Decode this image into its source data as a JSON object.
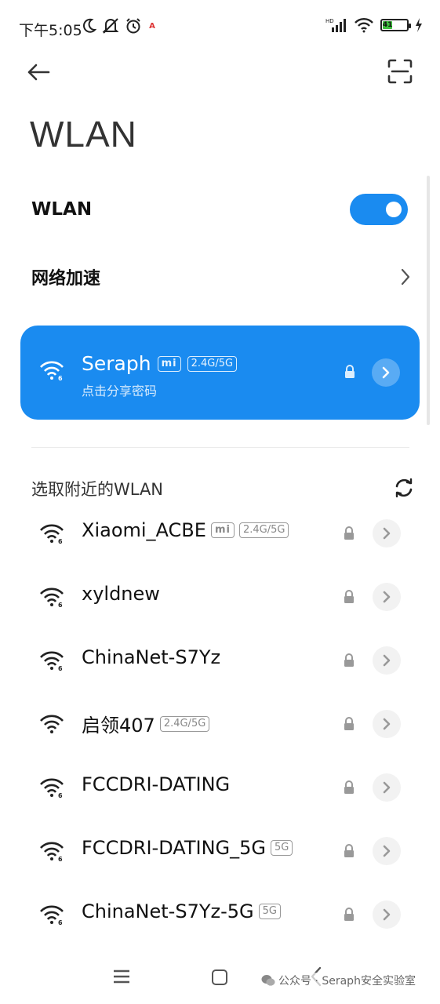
{
  "status_bar": {
    "time": "下午5:05",
    "battery_level": "41",
    "network_label": "HD",
    "left_icons": [
      "moon-icon",
      "mute-icon",
      "alarm-icon",
      "app-notification-icon"
    ],
    "right_icons": [
      "signal-icon",
      "wifi-icon",
      "battery-icon",
      "charging-icon"
    ]
  },
  "header": {
    "title": "WLAN",
    "back_icon": "back-arrow-icon",
    "scan_icon": "scan-icon"
  },
  "settings": {
    "wlan_label": "WLAN",
    "wlan_enabled": true,
    "accel_label": "网络加速"
  },
  "connected": {
    "ssid": "Seraph",
    "brand_tag": "mi",
    "band_tag": "2.4G/5G",
    "subtitle": "点击分享密码",
    "accent_color": "#1a8bf0"
  },
  "nearby": {
    "title": "选取附近的WLAN",
    "networks": [
      {
        "ssid": "Xiaomi_ACBE",
        "brand_tag": "mi",
        "band_tag": "2.4G/5G",
        "wifi6": true
      },
      {
        "ssid": "xyldnew",
        "brand_tag": "",
        "band_tag": "",
        "wifi6": true
      },
      {
        "ssid": "ChinaNet-S7Yz",
        "brand_tag": "",
        "band_tag": "",
        "wifi6": true
      },
      {
        "ssid": "启领407",
        "brand_tag": "",
        "band_tag": "2.4G/5G",
        "wifi6": false
      },
      {
        "ssid": "FCCDRI-DATING",
        "brand_tag": "",
        "band_tag": "",
        "wifi6": true
      },
      {
        "ssid": "FCCDRI-DATING_5G",
        "brand_tag": "",
        "band_tag": "5G",
        "wifi6": true
      },
      {
        "ssid": "ChinaNet-S7Yz-5G",
        "brand_tag": "",
        "band_tag": "5G",
        "wifi6": true
      }
    ]
  },
  "nav_bar": {
    "icons": [
      "menu-icon",
      "home-icon",
      "back-icon"
    ]
  },
  "watermark": {
    "text": "公众号 · Seraph安全实验室"
  }
}
